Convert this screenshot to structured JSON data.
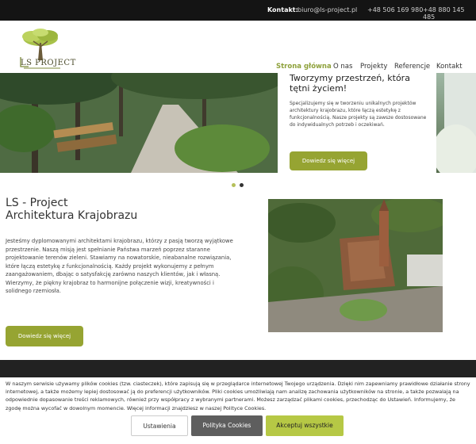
{
  "topbar": {
    "contact_label": "Kontakt:",
    "email": "biuro@ls-project.pl",
    "phone1": "+48 506 169 980",
    "phone2": "+48 880 145 485"
  },
  "logo": {
    "text": "LS PROJECT"
  },
  "nav": [
    "Strona główna",
    "O nas",
    "Projekty",
    "Referencje",
    "Kontakt"
  ],
  "hero": {
    "title": "Tworzymy przestrzeń, która tętni życiem!",
    "text": "Specjalizujemy się w tworzeniu unikalnych projektów architektury krajobrazu, które łączą estetykę z funkcjonalnością. Nasze projekty są zawsze dostosowane do indywidualnych potrzeb i oczekiwań.",
    "button": "Dowiedz się więcej"
  },
  "about": {
    "title_line1": "LS - Project",
    "title_line2": "Architektura Krajobrazu",
    "text": "Jesteśmy dyplomowanymi architektami krajobrazu, którzy z pasją tworzą wyjątkowe przestrzenie. Naszą misją jest spełnianie Państwa marzeń poprzez staranne projektowanie terenów zieleni. Stawiamy na nowatorskie, nieabanalne rozwiązania, które łączą estetykę z funkcjonalnością. Każdy projekt wykonujemy z pełnym zaangażowaniem, dbając o satysfakcję zarówno naszych klientów, jak i własną. Wierzymy, że piękny krajobraz to harmonijne połączenie wizji, kreatywności i solidnego rzemiosła.",
    "button": "Dowiedz się więcej"
  },
  "cookie": {
    "text": "W naszym serwisie używamy plików cookies (tzw. ciasteczek), które zapisują się w przeglądarce internetowej Twojego urządzenia. Dzięki nim zapewniamy prawidłowe działanie strony internetowej, a także możemy lepiej dostosować ją do preferencji użytkowników. Pliki cookies umożliwiają nam analizę zachowania użytkowników na stronie, a także pozwalają na odpowiednie dopasowanie treści reklamowych, również przy współpracy z wybranymi partnerami. Możesz zarządzać plikami cookies, przechodząc do Ustawień. Informujemy, że zgodę można wycofać w dowolnym momencie. Więcej informacji znajdziesz w naszej Polityce Cookies.",
    "settings": "Ustawienia",
    "policy": "Polityka Cookies",
    "accept": "Akceptuj wszystkie"
  },
  "colors": {
    "accent": "#96a432",
    "nav_active": "#8ea13b",
    "topbar": "#141414"
  },
  "icons": [
    "logo-tree-icon",
    "carousel-dot-icon"
  ]
}
